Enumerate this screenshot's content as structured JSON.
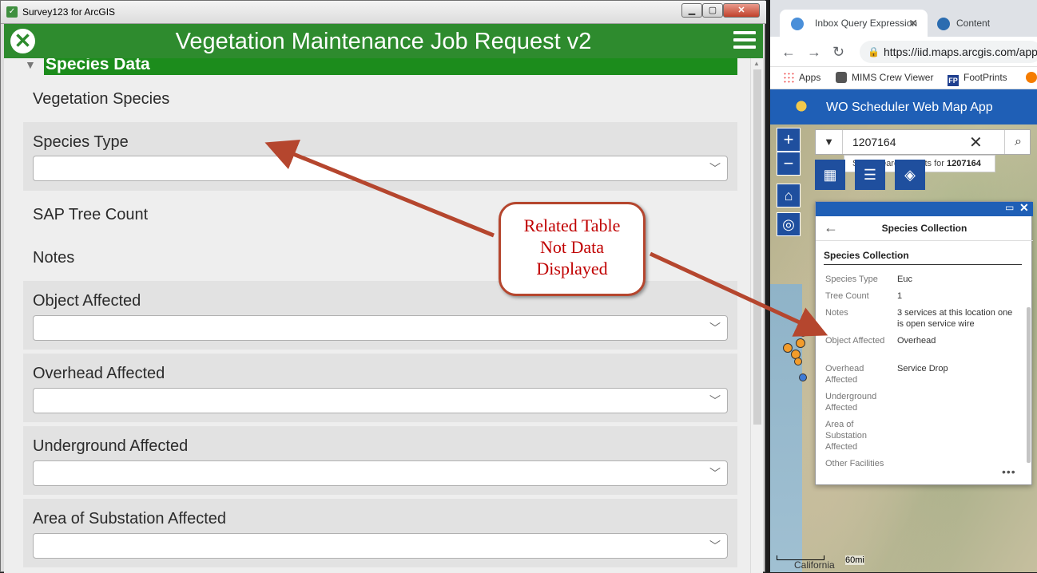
{
  "left_window": {
    "title": "Survey123 for ArcGIS",
    "controls": {
      "minimize": "▁",
      "maximize": "▢",
      "close": "✕"
    }
  },
  "survey": {
    "title": "Vegetation Maintenance Job Request v2",
    "group_title": "Species Data",
    "questions": [
      {
        "label": "Vegetation Species"
      },
      {
        "label": "Species Type"
      },
      {
        "label": "SAP Tree Count"
      },
      {
        "label": "Notes"
      },
      {
        "label": "Object Affected"
      },
      {
        "label": "Overhead Affected"
      },
      {
        "label": "Underground Affected"
      },
      {
        "label": "Area of Substation Affected"
      }
    ]
  },
  "callout": {
    "lines": [
      "Related Table",
      "Not Data",
      "Displayed"
    ]
  },
  "browser": {
    "tabs": [
      {
        "label": "Inbox Query Expression"
      },
      {
        "label": "Content"
      }
    ],
    "url": "https://iid.maps.arcgis.com/app",
    "bookmarks": [
      {
        "label": "Apps"
      },
      {
        "label": "MIMS Crew Viewer"
      },
      {
        "label": "FootPrints"
      }
    ]
  },
  "map_app": {
    "title": "WO Scheduler Web Map App",
    "search": {
      "value": "1207164",
      "hint_prefix": "Show search results for",
      "hint_value": "1207164"
    },
    "popup": {
      "title": "Species Collection",
      "layer_title": "Species Collection",
      "fields": [
        {
          "key": "Species Type",
          "value": "Euc"
        },
        {
          "key": "Tree Count",
          "value": "1"
        },
        {
          "key": "Notes",
          "value": "3 services at this location one is open service wire"
        },
        {
          "key": "Object Affected",
          "value": "Overhead"
        },
        {
          "key": "Overhead Affected",
          "value": "Service Drop"
        },
        {
          "key": "Underground Affected",
          "value": ""
        },
        {
          "key": "Area of Substation Affected",
          "value": ""
        },
        {
          "key": "Other Facilities",
          "value": ""
        }
      ]
    },
    "scale_label": "60mi",
    "map_place_label": "California",
    "colors": {
      "header_blue": "#1f5fb6",
      "survey_green": "#2e8b2e",
      "marker_orange": "#f39c2b"
    }
  }
}
